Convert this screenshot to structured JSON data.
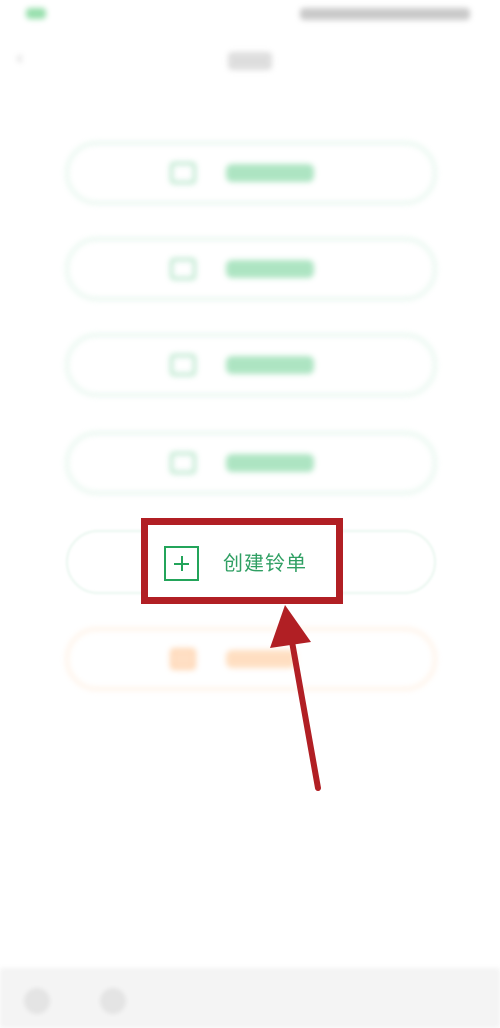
{
  "create_button": {
    "label": "创建铃单",
    "icon": "plus-square-icon"
  },
  "colors": {
    "accent_green": "#2f9f63",
    "highlight_red": "#b11f24",
    "orange_light": "#ffd5b1"
  }
}
